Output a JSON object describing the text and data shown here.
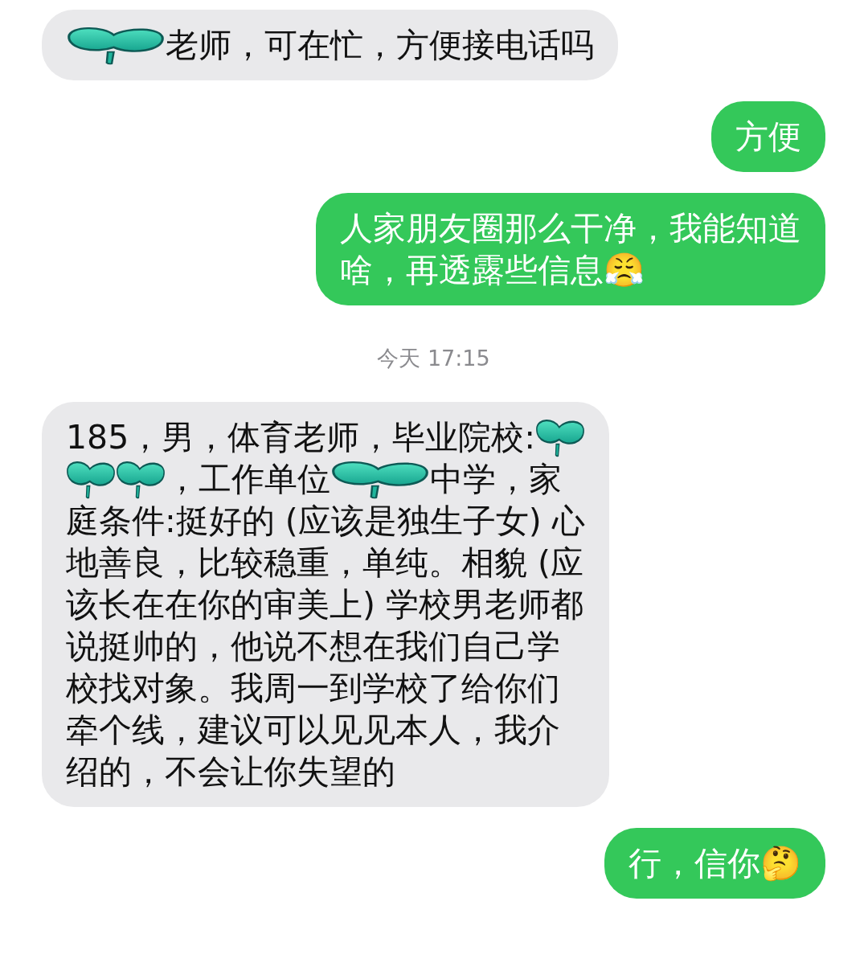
{
  "messages": [
    {
      "kind": "received",
      "lines": [
        [
          {
            "kind": "wide-sticker"
          },
          "老师，可在忙，方便接电话吗"
        ]
      ]
    },
    {
      "kind": "sent",
      "lines": [
        [
          "方便"
        ]
      ]
    },
    {
      "kind": "sent",
      "lines": [
        [
          "人家朋友圈那么干净，我能知道"
        ],
        [
          "啥，再透露些信息😤"
        ]
      ]
    },
    {
      "kind": "timestamp",
      "text": "今天 17:15"
    },
    {
      "kind": "received",
      "lines": [
        [
          "185，男，体育老师，毕业院校:",
          {
            "kind": "sticker"
          }
        ],
        [
          {
            "kind": "sticker"
          },
          {
            "kind": "sticker"
          },
          "，工作单位",
          {
            "kind": "wide-sticker"
          },
          "中学，家"
        ],
        [
          "庭条件:挺好的 (应该是独生子女) 心"
        ],
        [
          "地善良，比较稳重，单纯。相貌 (应"
        ],
        [
          "该长在在你的审美上) 学校男老师都"
        ],
        [
          "说挺帅的，他说不想在我们自己学"
        ],
        [
          "校找对象。我周一到学校了给你们"
        ],
        [
          "牵个线，建议可以见见本人，我介"
        ],
        [
          "绍的，不会让你失望的"
        ]
      ]
    },
    {
      "kind": "sent",
      "lines": [
        [
          "行，信你🤔"
        ]
      ]
    }
  ]
}
